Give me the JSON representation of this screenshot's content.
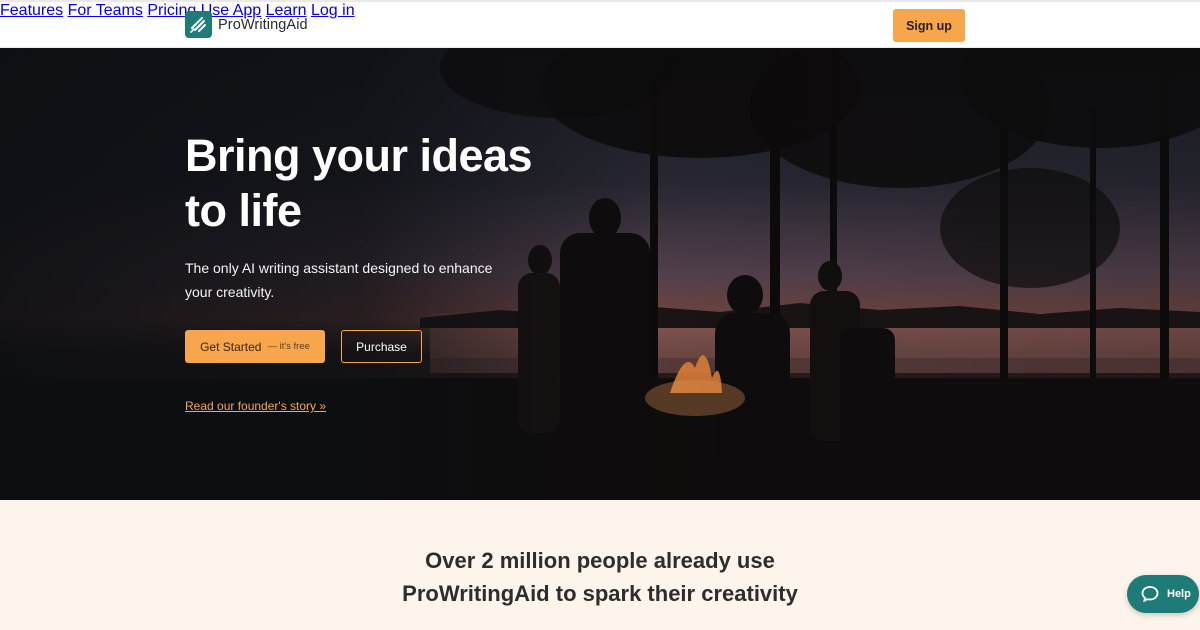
{
  "header": {
    "brand": "ProWritingAid",
    "nav": [
      "Features",
      "For Teams",
      "Pricing",
      "Use App",
      "Learn",
      "Log in"
    ],
    "signup_label": "Sign up"
  },
  "hero": {
    "title": "Bring your ideas to life",
    "subtitle": "The only AI writing assistant designed to enhance your creativity.",
    "primary_cta": "Get Started",
    "primary_cta_note": "— it's free",
    "secondary_cta": "Purchase",
    "story_link": "Read our founder's story »"
  },
  "band": {
    "headline": "Over 2 million people already use ProWritingAid to spark their creativity"
  },
  "help": {
    "label": "Help"
  },
  "colors": {
    "accent": "#f7a64b",
    "brand_teal": "#1f7b78",
    "band_bg": "#fdf4ec"
  }
}
